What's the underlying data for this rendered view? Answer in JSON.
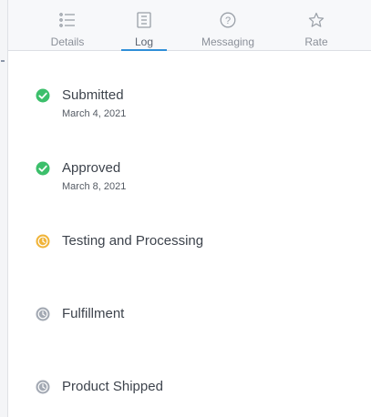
{
  "colors": {
    "accent": "#2f8fd8",
    "complete": "#3cbf6b",
    "in_progress": "#f0b43a",
    "pending": "#a3a9b3"
  },
  "tabs": [
    {
      "label": "Details",
      "icon": "list-icon"
    },
    {
      "label": "Log",
      "icon": "log-icon",
      "active": true
    },
    {
      "label": "Messaging",
      "icon": "help-circle-icon"
    },
    {
      "label": "Rate",
      "icon": "star-icon"
    }
  ],
  "timeline": [
    {
      "title": "Submitted",
      "date": "March 4, 2021",
      "status": "complete",
      "icon": "check-circle-icon"
    },
    {
      "title": "Approved",
      "date": "March 8, 2021",
      "status": "complete",
      "icon": "check-circle-icon"
    },
    {
      "title": "Testing and Processing",
      "status": "in_progress",
      "icon": "clock-icon"
    },
    {
      "title": "Fulfillment",
      "status": "pending",
      "icon": "clock-icon"
    },
    {
      "title": "Product Shipped",
      "status": "pending",
      "icon": "clock-icon"
    }
  ]
}
